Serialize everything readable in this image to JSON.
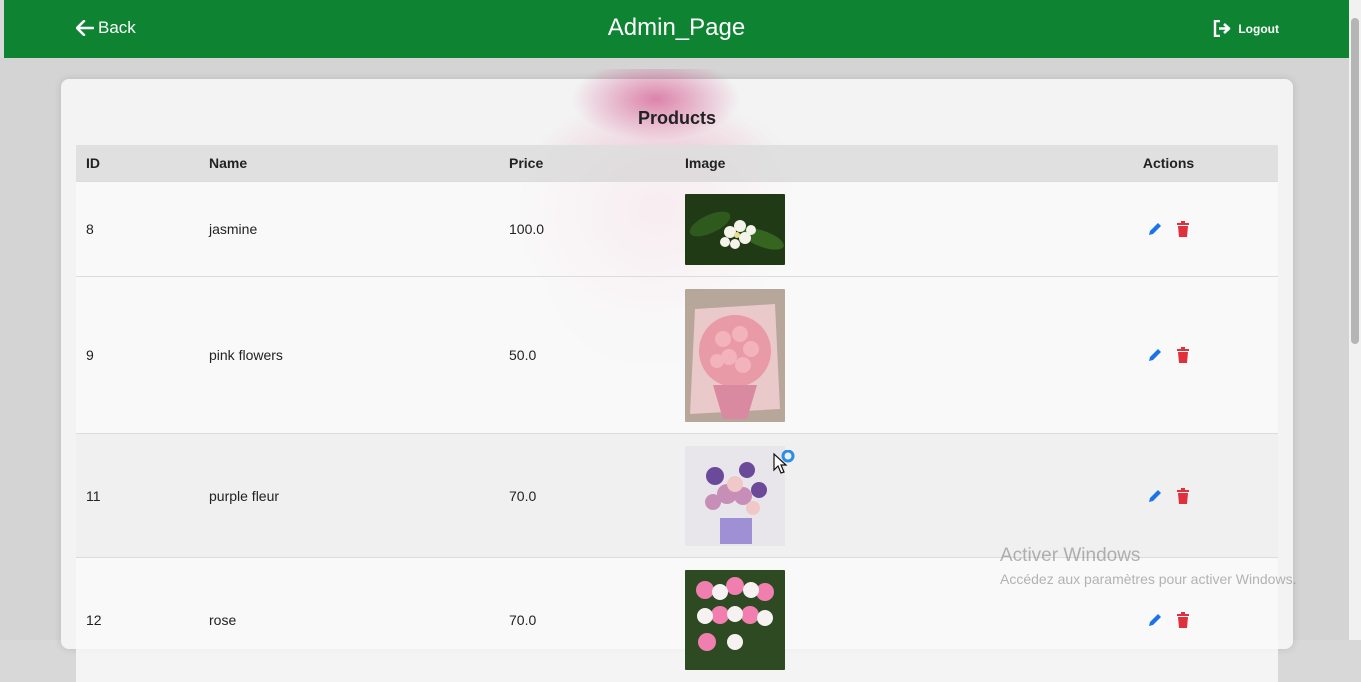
{
  "header": {
    "back_label": "Back",
    "title": "Admin_Page",
    "logout_label": "Logout",
    "color": "#0e8433"
  },
  "products_card": {
    "title": "Products",
    "columns": [
      "ID",
      "Name",
      "Price",
      "Image",
      "Actions"
    ],
    "rows": [
      {
        "id": "8",
        "name": "jasmine",
        "price": "100.0",
        "image": "white-jasmine-flowers-photo"
      },
      {
        "id": "9",
        "name": "pink flowers",
        "price": "50.0",
        "image": "pink-rose-bouquet-photo"
      },
      {
        "id": "11",
        "name": "purple fleur",
        "price": "70.0",
        "image": "purple-flower-arrangement-photo"
      },
      {
        "id": "12",
        "name": "rose",
        "price": "70.0",
        "image": "pink-white-roses-photo"
      }
    ],
    "edit_icon": "pencil-icon",
    "delete_icon": "trash-icon",
    "edit_color": "#1a73e8",
    "delete_color": "#e0303c"
  },
  "watermark": {
    "title": "Activer Windows",
    "subtitle": "Accédez aux paramètres pour activer Windows."
  }
}
